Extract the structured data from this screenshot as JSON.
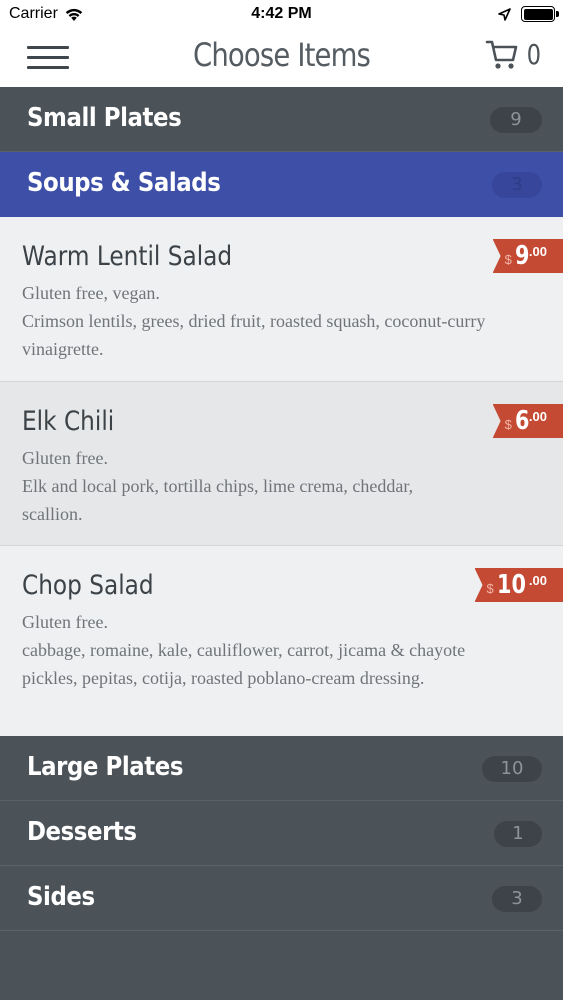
{
  "status": {
    "carrier": "Carrier",
    "time": "4:42 PM"
  },
  "header": {
    "title": "Choose Items",
    "cart_count": "0"
  },
  "categories": [
    {
      "label": "Small Plates",
      "count": "9"
    },
    {
      "label": "Soups & Salads",
      "count": "3"
    },
    {
      "label": "Large Plates",
      "count": "10"
    },
    {
      "label": "Desserts",
      "count": "1"
    },
    {
      "label": "Sides",
      "count": "3"
    }
  ],
  "items": [
    {
      "name": "Warm Lentil Salad",
      "tag": "Gluten free, vegan.",
      "description": "Crimson lentils, grees, dried fruit, roasted squash, coconut-curry vinaigrette.",
      "price_symbol": "$",
      "price_dollars": "9",
      "price_cents": ".00"
    },
    {
      "name": "Elk Chili",
      "tag": "Gluten free.",
      "description": "Elk and local pork, tortilla chips, lime crema, cheddar, scallion.",
      "price_symbol": "$",
      "price_dollars": "6",
      "price_cents": ".00"
    },
    {
      "name": "Chop Salad",
      "tag": "Gluten free.",
      "description": "cabbage, romaine, kale, cauliflower, carrot, jicama & chayote pickles, pepitas, cotija, roasted poblano-cream dressing.",
      "price_symbol": "$",
      "price_dollars": "10",
      "price_cents": ".00"
    }
  ],
  "colors": {
    "active_category": "#3e4fa8",
    "category_bg": "#4b5258",
    "price_tag": "#c44a33",
    "item_bg": "#eff0f2"
  },
  "icons": [
    "wifi-icon",
    "location-arrow-icon",
    "battery-icon",
    "hamburger-menu-icon",
    "cart-icon"
  ]
}
